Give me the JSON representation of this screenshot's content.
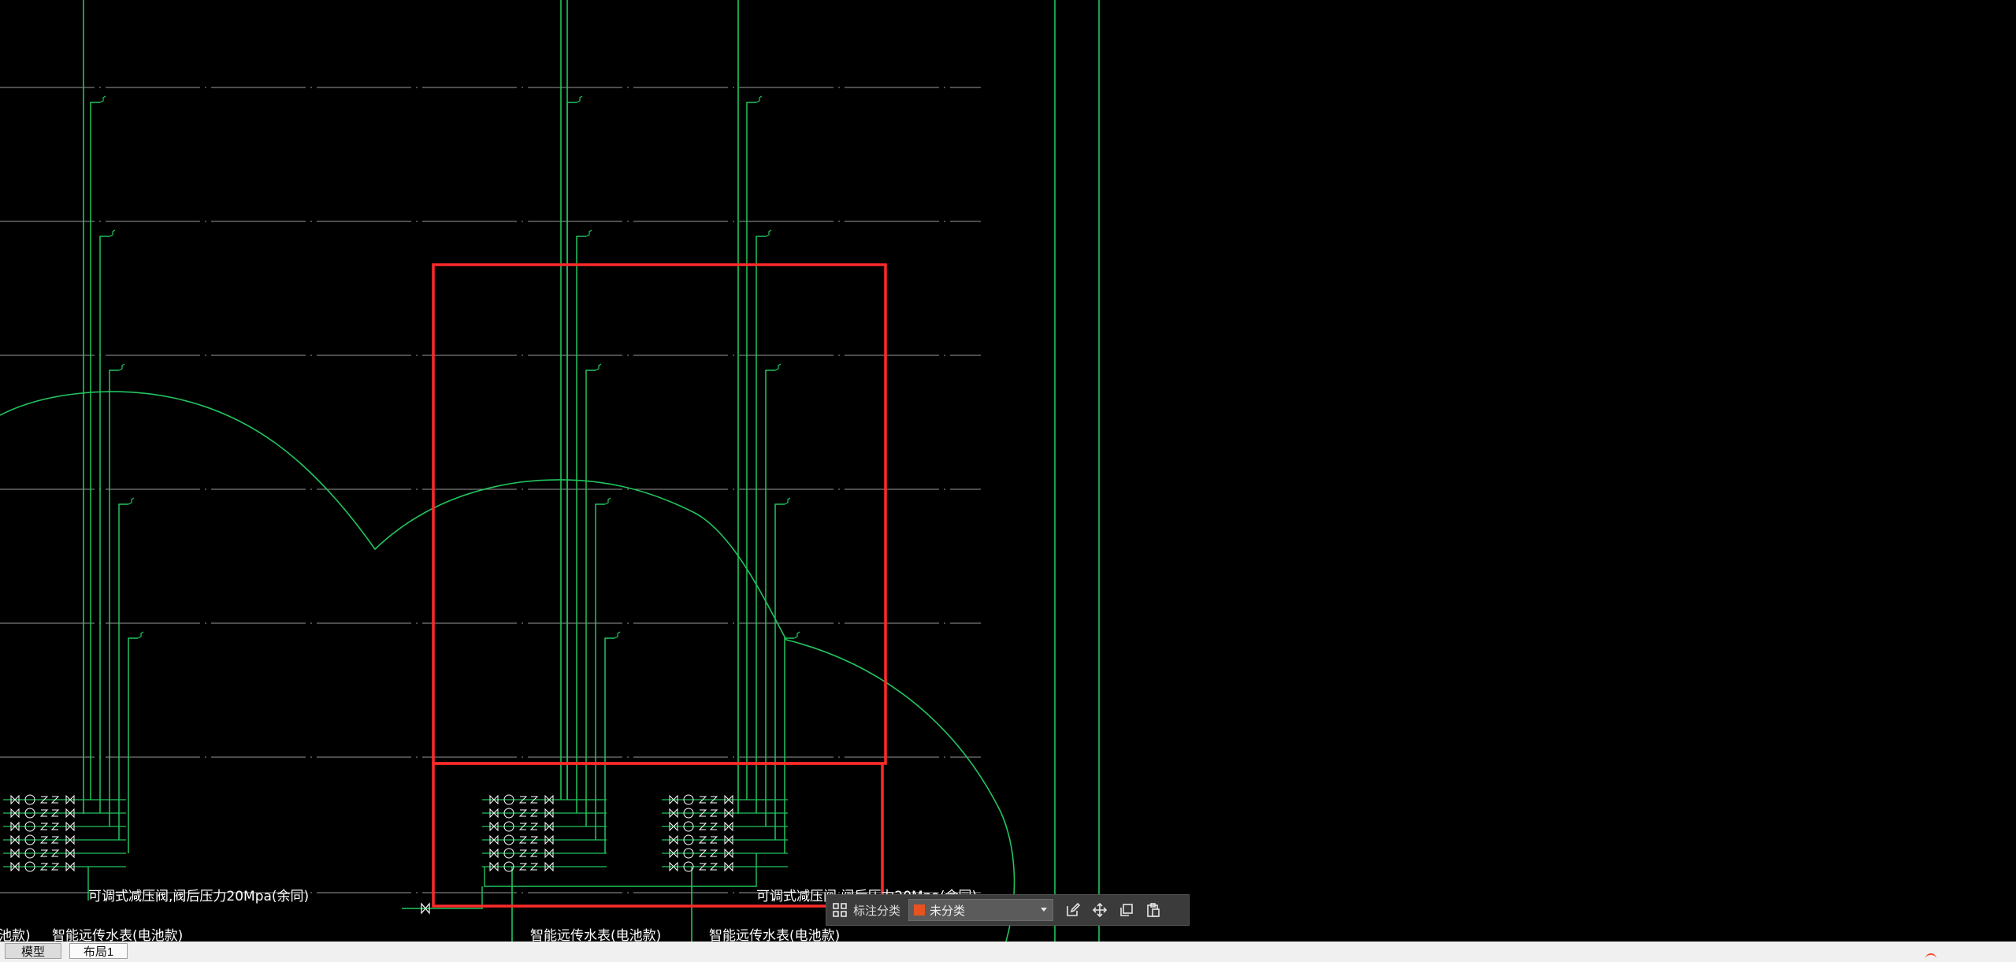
{
  "drawing": {
    "labels": {
      "prv_left": "可调式减压阀,阀后压力20Mpa(余同)",
      "prv_right": "可调式减压阀,阀后压力20Mpa(余同)",
      "meter_left": "智能远传水表(电池款)",
      "meter_mid1": "智能远传水表(电池款)",
      "meter_mid2": "智能远传水表(电池款)",
      "edge_left": "池款)"
    },
    "colors": {
      "pipe": "#22c55e",
      "highlight": "#ff2a2a",
      "grid": "#9a9a9a",
      "background": "#000000"
    }
  },
  "annotation_toolbar": {
    "classify_label": "标注分类",
    "selected_category": "未分类",
    "category_color": "#e8521f",
    "icons": [
      "grid-icon",
      "edit-icon",
      "move-icon",
      "copy-icon",
      "paste-icon",
      "chevron-down-icon"
    ]
  },
  "layout_tabs": [
    {
      "label": "模型",
      "active": true
    },
    {
      "label": "布局1",
      "active": false
    }
  ]
}
